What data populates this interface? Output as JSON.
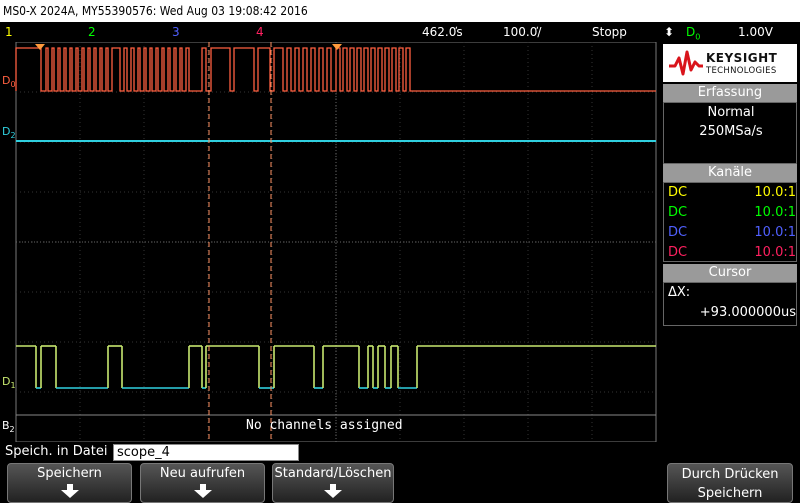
{
  "title": "MS0-X 2024A, MY55390576: Wed Aug 03 19:08:42 2016",
  "status": {
    "ch1": "1",
    "ch2": "2",
    "ch3": "3",
    "ch4": "4",
    "timebase": "462.0̕s",
    "timeref": "100.0̕/",
    "mode": "Stopp",
    "trigger_source": "D",
    "trigger_source_sub": "0",
    "trigger_level": "1.00V"
  },
  "channel_labels": {
    "d0": "D",
    "d0_sub": "0",
    "d2": "D",
    "d2_sub": "2",
    "d1": "D",
    "d1_sub": "1",
    "b2": "B",
    "b2_sub": "2"
  },
  "no_channels": "No channels assigned",
  "brand": {
    "name": "KEYSIGHT",
    "sub": "TECHNOLOGIES"
  },
  "acquisition": {
    "header": "Erfassung",
    "mode": "Normal",
    "rate": "250MSa/s"
  },
  "channels": {
    "header": "Kanäle",
    "rows": [
      {
        "coupling": "DC",
        "probe": "10.0:1",
        "color": "#ffff00"
      },
      {
        "coupling": "DC",
        "probe": "10.0:1",
        "color": "#00ff00"
      },
      {
        "coupling": "DC",
        "probe": "10.0:1",
        "color": "#5060ff"
      },
      {
        "coupling": "DC",
        "probe": "10.0:1",
        "color": "#ff2060"
      }
    ]
  },
  "cursor": {
    "header": "Cursor",
    "delta_label": "ΔX:",
    "delta_value": "+93.000000us"
  },
  "file": {
    "label": "Speich. in Datei =",
    "value": "scope_4"
  },
  "softkeys": [
    {
      "label": "Speichern"
    },
    {
      "label": "Neu aufrufen"
    },
    {
      "label": "Standard/Löschen"
    },
    {
      "label": "Durch Drücken Speichern"
    }
  ],
  "colors": {
    "d0_trace": "#ff6040",
    "d2_trace": "#30d0e0",
    "d1_trace_high": "#c8e870",
    "d1_trace_low": "#30d0e0",
    "cursor": "#ff9060",
    "grid": "#555555"
  }
}
